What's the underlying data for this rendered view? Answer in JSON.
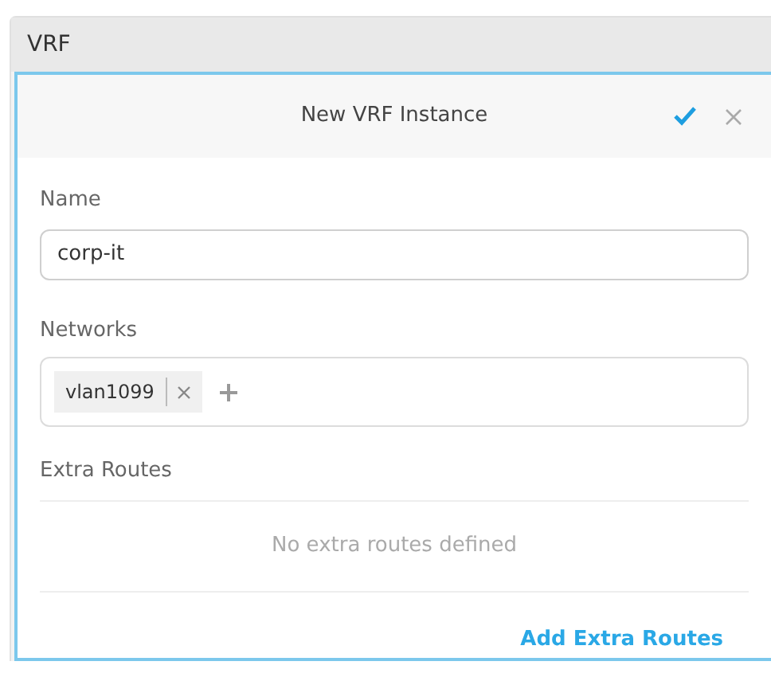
{
  "section": {
    "title": "VRF"
  },
  "dialog": {
    "title": "New VRF Instance",
    "name_field": {
      "label": "Name",
      "value": "corp-it"
    },
    "networks_field": {
      "label": "Networks",
      "tags": [
        {
          "label": "vlan1099"
        }
      ]
    },
    "extra_routes": {
      "label": "Extra Routes",
      "empty_text": "No extra routes defined"
    },
    "add_button": "Add Extra Routes"
  }
}
